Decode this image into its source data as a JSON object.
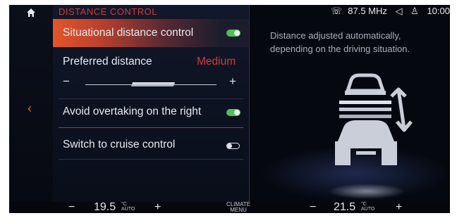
{
  "panel": {
    "title": "DISTANCE CONTROL",
    "items": [
      {
        "label": "Situational distance control",
        "toggle": "on"
      },
      {
        "label": "Preferred distance",
        "value": "Medium",
        "slider_level": "medium"
      },
      {
        "label": "Avoid overtaking on the right",
        "toggle": "on"
      },
      {
        "label": "Switch to cruise control",
        "toggle": "off"
      }
    ],
    "slider": {
      "minus": "−",
      "plus": "+"
    }
  },
  "status": {
    "radio": "87.5 MHz",
    "time": "10:00"
  },
  "info": {
    "line1": "Distance adjusted automatically,",
    "line2": "depending on the driving situation."
  },
  "climate": {
    "left": {
      "minus": "−",
      "temp": "19.5",
      "unit_top": "°C",
      "unit_bottom": "AUTO",
      "plus": "+"
    },
    "center_line1": "CLIMATE",
    "center_line2": "MENU",
    "right": {
      "minus": "−",
      "temp": "21.5",
      "unit_top": "°C",
      "unit_bottom": "AUTO",
      "plus": "+"
    }
  },
  "colors": {
    "accent_red": "#d13b3b",
    "toggle_on": "#4fbf58",
    "back_arrow": "#e0662e"
  },
  "icons": [
    "home-icon",
    "back-arrow-icon",
    "phone-icon",
    "volume-icon",
    "user-icon",
    "toggle-icon",
    "distance-cars-icon"
  ]
}
